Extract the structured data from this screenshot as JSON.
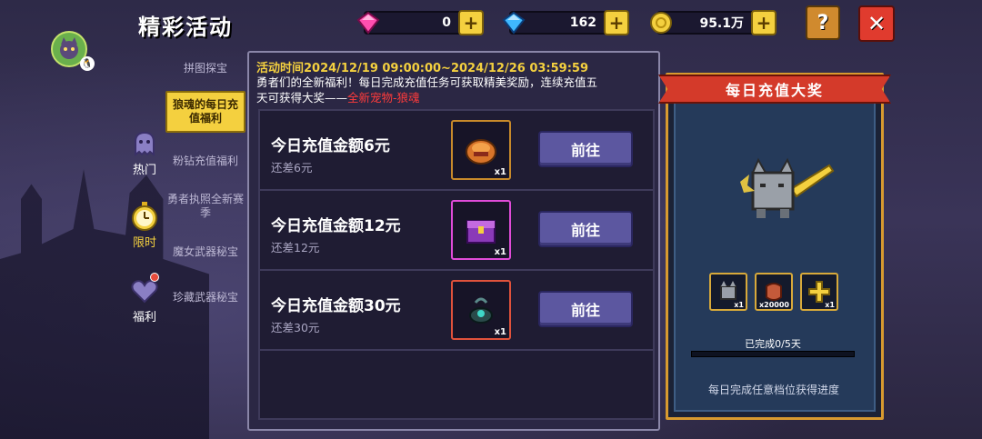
{
  "header": {
    "title": "精彩活动",
    "gems": "0",
    "diamonds": "162",
    "coins": "95.1万",
    "help_label": "?",
    "close_label": "✕"
  },
  "categories": [
    {
      "label": "热门",
      "active": false
    },
    {
      "label": "限时",
      "active": true
    },
    {
      "label": "福利",
      "active": false
    }
  ],
  "menu": {
    "items": [
      {
        "label": "拼图探宝"
      },
      {
        "label": "狼魂的每日充值福利"
      },
      {
        "label": "粉钻充值福利"
      },
      {
        "label": "勇者执照全新赛季"
      },
      {
        "label": "魔女武器秘宝"
      },
      {
        "label": "珍藏武器秘宝"
      }
    ],
    "active_index": 1
  },
  "event": {
    "time": "活动时间2024/12/19 09:00:00~2024/12/26 03:59:59",
    "desc_line1": "勇者们的全新福利！每日完成充值任务可获取精美奖励，连续充值五",
    "desc_line2_prefix": "天可获得大奖——",
    "desc_highlight": "全新宠物-狼魂"
  },
  "tasks": [
    {
      "title": "今日充值金额6元",
      "remaining": "还差6元",
      "count": "x1",
      "button": "前往"
    },
    {
      "title": "今日充值金额12元",
      "remaining": "还差12元",
      "count": "x1",
      "button": "前往"
    },
    {
      "title": "今日充值金额30元",
      "remaining": "还差30元",
      "count": "x1",
      "button": "前往"
    }
  ],
  "prize": {
    "ribbon": "每日充值大奖",
    "rewards": [
      {
        "count": "x1"
      },
      {
        "count": "x20000"
      },
      {
        "count": "x1"
      }
    ],
    "progress_text": "已完成0/5天",
    "progress_fraction": 0,
    "note": "每日完成任意档位获得进度"
  },
  "colors": {
    "accent_yellow": "#f4d03f",
    "highlight_red": "#ff3b3b",
    "button_purple": "#5c57a0"
  }
}
